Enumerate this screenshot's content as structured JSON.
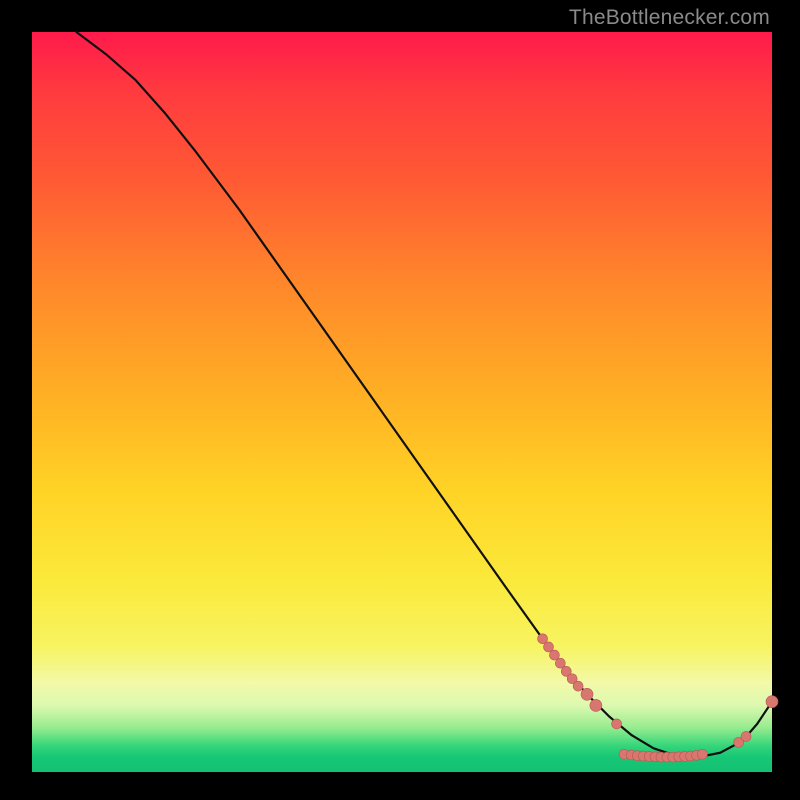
{
  "watermark": "TheBottlenecker.com",
  "colors": {
    "background": "#000000",
    "curve": "#111111",
    "marker_fill": "#d8766f",
    "marker_stroke": "#b55a52"
  },
  "chart_data": {
    "type": "line",
    "title": "",
    "xlabel": "",
    "ylabel": "",
    "xlim": [
      0,
      100
    ],
    "ylim": [
      0,
      100
    ],
    "series": [
      {
        "name": "bottleneck-curve",
        "x": [
          6,
          10,
          14,
          18,
          22,
          28,
          34,
          40,
          46,
          52,
          58,
          64,
          69,
          72,
          75,
          78,
          81,
          84,
          87,
          90,
          93,
          96,
          98,
          100
        ],
        "y": [
          100,
          97,
          93.5,
          89,
          84,
          76,
          67.5,
          59,
          50.5,
          42,
          33.5,
          25,
          18,
          14,
          10.5,
          7.5,
          5,
          3.2,
          2.2,
          2,
          2.6,
          4.2,
          6.5,
          9.5
        ]
      }
    ],
    "markers": {
      "name": "highlight-points",
      "points": [
        {
          "x": 69.0,
          "y": 18.0,
          "r": 5
        },
        {
          "x": 69.8,
          "y": 16.9,
          "r": 5
        },
        {
          "x": 70.6,
          "y": 15.8,
          "r": 5
        },
        {
          "x": 71.4,
          "y": 14.7,
          "r": 5
        },
        {
          "x": 72.2,
          "y": 13.6,
          "r": 5
        },
        {
          "x": 73.0,
          "y": 12.6,
          "r": 5
        },
        {
          "x": 73.8,
          "y": 11.6,
          "r": 5
        },
        {
          "x": 75.0,
          "y": 10.5,
          "r": 6
        },
        {
          "x": 76.2,
          "y": 9.0,
          "r": 6
        },
        {
          "x": 79.0,
          "y": 6.5,
          "r": 5
        },
        {
          "x": 80.0,
          "y": 2.4,
          "r": 5
        },
        {
          "x": 81.0,
          "y": 2.3,
          "r": 5
        },
        {
          "x": 81.8,
          "y": 2.2,
          "r": 5
        },
        {
          "x": 82.6,
          "y": 2.15,
          "r": 5
        },
        {
          "x": 83.4,
          "y": 2.1,
          "r": 5
        },
        {
          "x": 84.2,
          "y": 2.05,
          "r": 5
        },
        {
          "x": 85.0,
          "y": 2.0,
          "r": 5
        },
        {
          "x": 85.8,
          "y": 2.0,
          "r": 5
        },
        {
          "x": 86.6,
          "y": 2.0,
          "r": 5
        },
        {
          "x": 87.4,
          "y": 2.05,
          "r": 5
        },
        {
          "x": 88.2,
          "y": 2.1,
          "r": 5
        },
        {
          "x": 89.0,
          "y": 2.15,
          "r": 5
        },
        {
          "x": 89.8,
          "y": 2.25,
          "r": 5
        },
        {
          "x": 90.6,
          "y": 2.4,
          "r": 5
        },
        {
          "x": 95.5,
          "y": 4.0,
          "r": 5
        },
        {
          "x": 96.5,
          "y": 4.8,
          "r": 5
        },
        {
          "x": 100.0,
          "y": 9.5,
          "r": 6
        }
      ]
    }
  }
}
